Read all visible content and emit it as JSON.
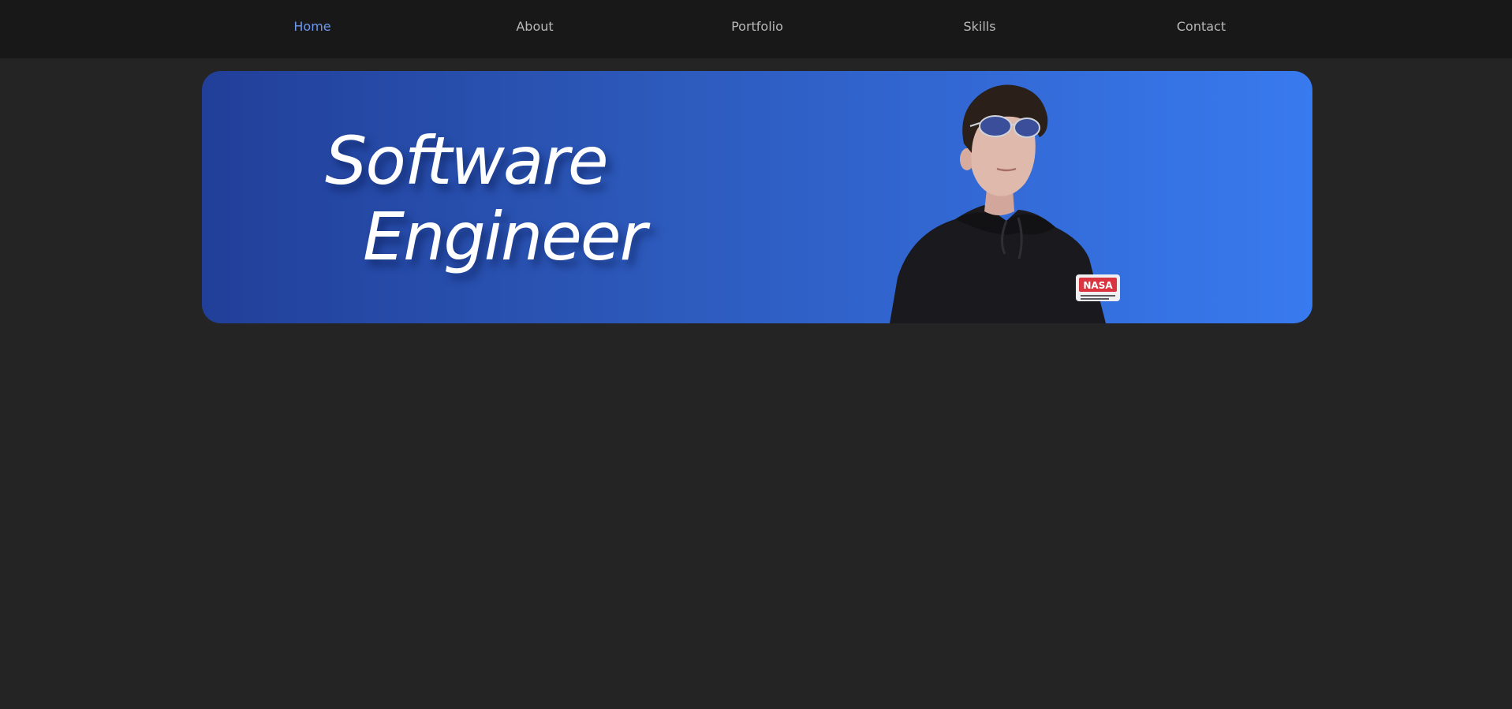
{
  "nav": {
    "items": [
      {
        "label": "Home",
        "active": true
      },
      {
        "label": "About",
        "active": false
      },
      {
        "label": "Portfolio",
        "active": false
      },
      {
        "label": "Skills",
        "active": false
      },
      {
        "label": "Contact",
        "active": false
      }
    ],
    "colors": {
      "background": "#181818",
      "text": "#b9b9b9",
      "active": "#6b98ee"
    }
  },
  "hero": {
    "headline_line1": "Software",
    "headline_line2": "Engineer",
    "photo_icon": "person-portrait",
    "photo_badge_text": "NASA",
    "colors": {
      "gradient_start": "#213f99",
      "gradient_end": "#387aef",
      "text": "#ffffff"
    }
  },
  "page": {
    "background": "#242424"
  }
}
